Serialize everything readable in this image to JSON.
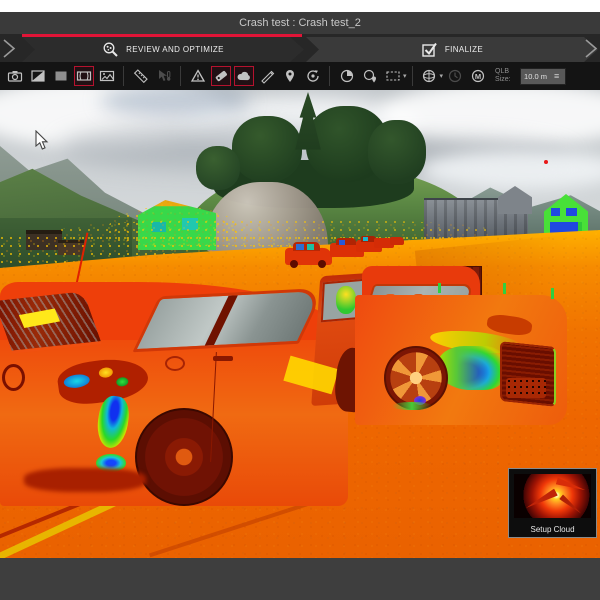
{
  "window": {
    "title": "Crash test : Crash test_2"
  },
  "workflow": {
    "tabs": [
      {
        "label": "REVIEW AND OPTIMIZE",
        "icon": "point-cloud-magnifier-icon",
        "active": true
      },
      {
        "label": "FINALIZE",
        "icon": "checkbox-icon",
        "active": false
      }
    ]
  },
  "toolbar": {
    "buttons": [
      {
        "name": "camera-view"
      },
      {
        "name": "split-view"
      },
      {
        "name": "solid-color-view"
      },
      {
        "name": "panorama-view",
        "highlighted": true
      },
      {
        "name": "image-view"
      },
      {
        "name": "measure-ruler"
      },
      {
        "name": "cursor-temperature",
        "disabled": true
      },
      {
        "name": "warning-marker"
      },
      {
        "name": "tag-annotation",
        "highlighted": true
      },
      {
        "name": "cloud-annotation",
        "highlighted": true
      },
      {
        "name": "measure-pen"
      },
      {
        "name": "location-pin"
      },
      {
        "name": "user-rotate"
      },
      {
        "name": "sphere-pie"
      },
      {
        "name": "sphere-pin"
      },
      {
        "name": "rectangle-selection",
        "has_dropdown": true
      },
      {
        "name": "view-globe",
        "has_dropdown": true
      },
      {
        "name": "sphere-clock",
        "disabled": true
      },
      {
        "name": "sphere-m"
      }
    ],
    "qlb": {
      "label": "QLB Size:",
      "value": "10.0 m"
    }
  },
  "viewport": {
    "scene": "crash-test heatmap point cloud over photo background",
    "setup_cloud_label": "Setup Cloud"
  },
  "colors": {
    "accent_red": "#e11437",
    "ground_orange": "#ee6a00",
    "scatter_yellow": "#ffc400",
    "car_red": "#ee3d0c",
    "heat_blue": "#1446ff",
    "heat_cyan": "#18c8d8",
    "heat_green": "#30d830",
    "highlight_green": "#3ee04a"
  }
}
